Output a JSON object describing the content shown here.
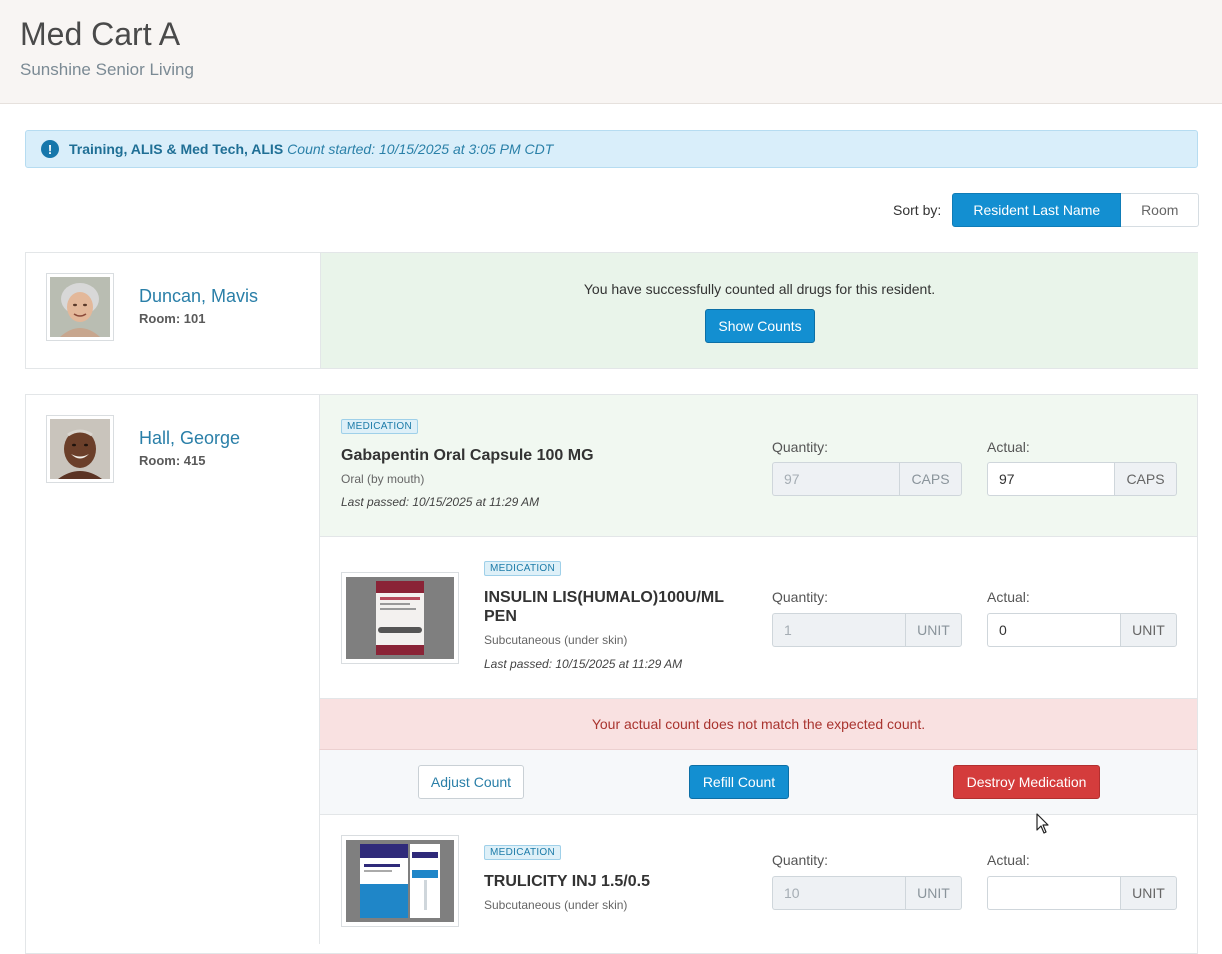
{
  "header": {
    "title": "Med Cart A",
    "subtitle": "Sunshine Senior Living"
  },
  "count_alert": {
    "icon": "exclamation-circle-icon",
    "users": "Training, ALIS & Med Tech, ALIS",
    "started": "Count started: 10/15/2025 at 3:05 PM CDT"
  },
  "sort": {
    "label": "Sort by:",
    "options": [
      "Resident Last Name",
      "Room"
    ],
    "selected": "Resident Last Name"
  },
  "residents": [
    {
      "name": "Duncan, Mavis",
      "room": "Room: 101",
      "status_message": "You have successfully counted all drugs for this resident.",
      "show_counts_label": "Show Counts"
    },
    {
      "name": "Hall, George",
      "room": "Room: 415",
      "medications": [
        {
          "badge": "MEDICATION",
          "name": "Gabapentin Oral Capsule 100 MG",
          "route": "Oral (by mouth)",
          "last_passed": "Last passed: 10/15/2025 at 11:29 AM",
          "quantity_label": "Quantity:",
          "quantity": "97",
          "unit": "CAPS",
          "actual_label": "Actual:",
          "actual": "97"
        },
        {
          "badge": "MEDICATION",
          "name": "INSULIN LIS(HUMALO)100U/ML PEN",
          "route": "Subcutaneous (under skin)",
          "last_passed": "Last passed: 10/15/2025 at 11:29 AM",
          "quantity_label": "Quantity:",
          "quantity": "1",
          "unit": "UNIT",
          "actual_label": "Actual:",
          "actual": "0",
          "error_message": "Your actual count does not match the expected count.",
          "actions": {
            "adjust": "Adjust Count",
            "refill": "Refill Count",
            "destroy": "Destroy Medication"
          }
        },
        {
          "badge": "MEDICATION",
          "name": "TRULICITY INJ 1.5/0.5",
          "route": "Subcutaneous (under skin)",
          "quantity_label": "Quantity:",
          "quantity": "10",
          "unit": "UNIT",
          "actual_label": "Actual:",
          "actual": ""
        }
      ]
    }
  ],
  "colors": {
    "primary": "#138fd1",
    "danger": "#d43c3c",
    "success_bg": "#e9f4ea",
    "error_bg": "#f9e1e1",
    "info_bg": "#d9eefa"
  }
}
